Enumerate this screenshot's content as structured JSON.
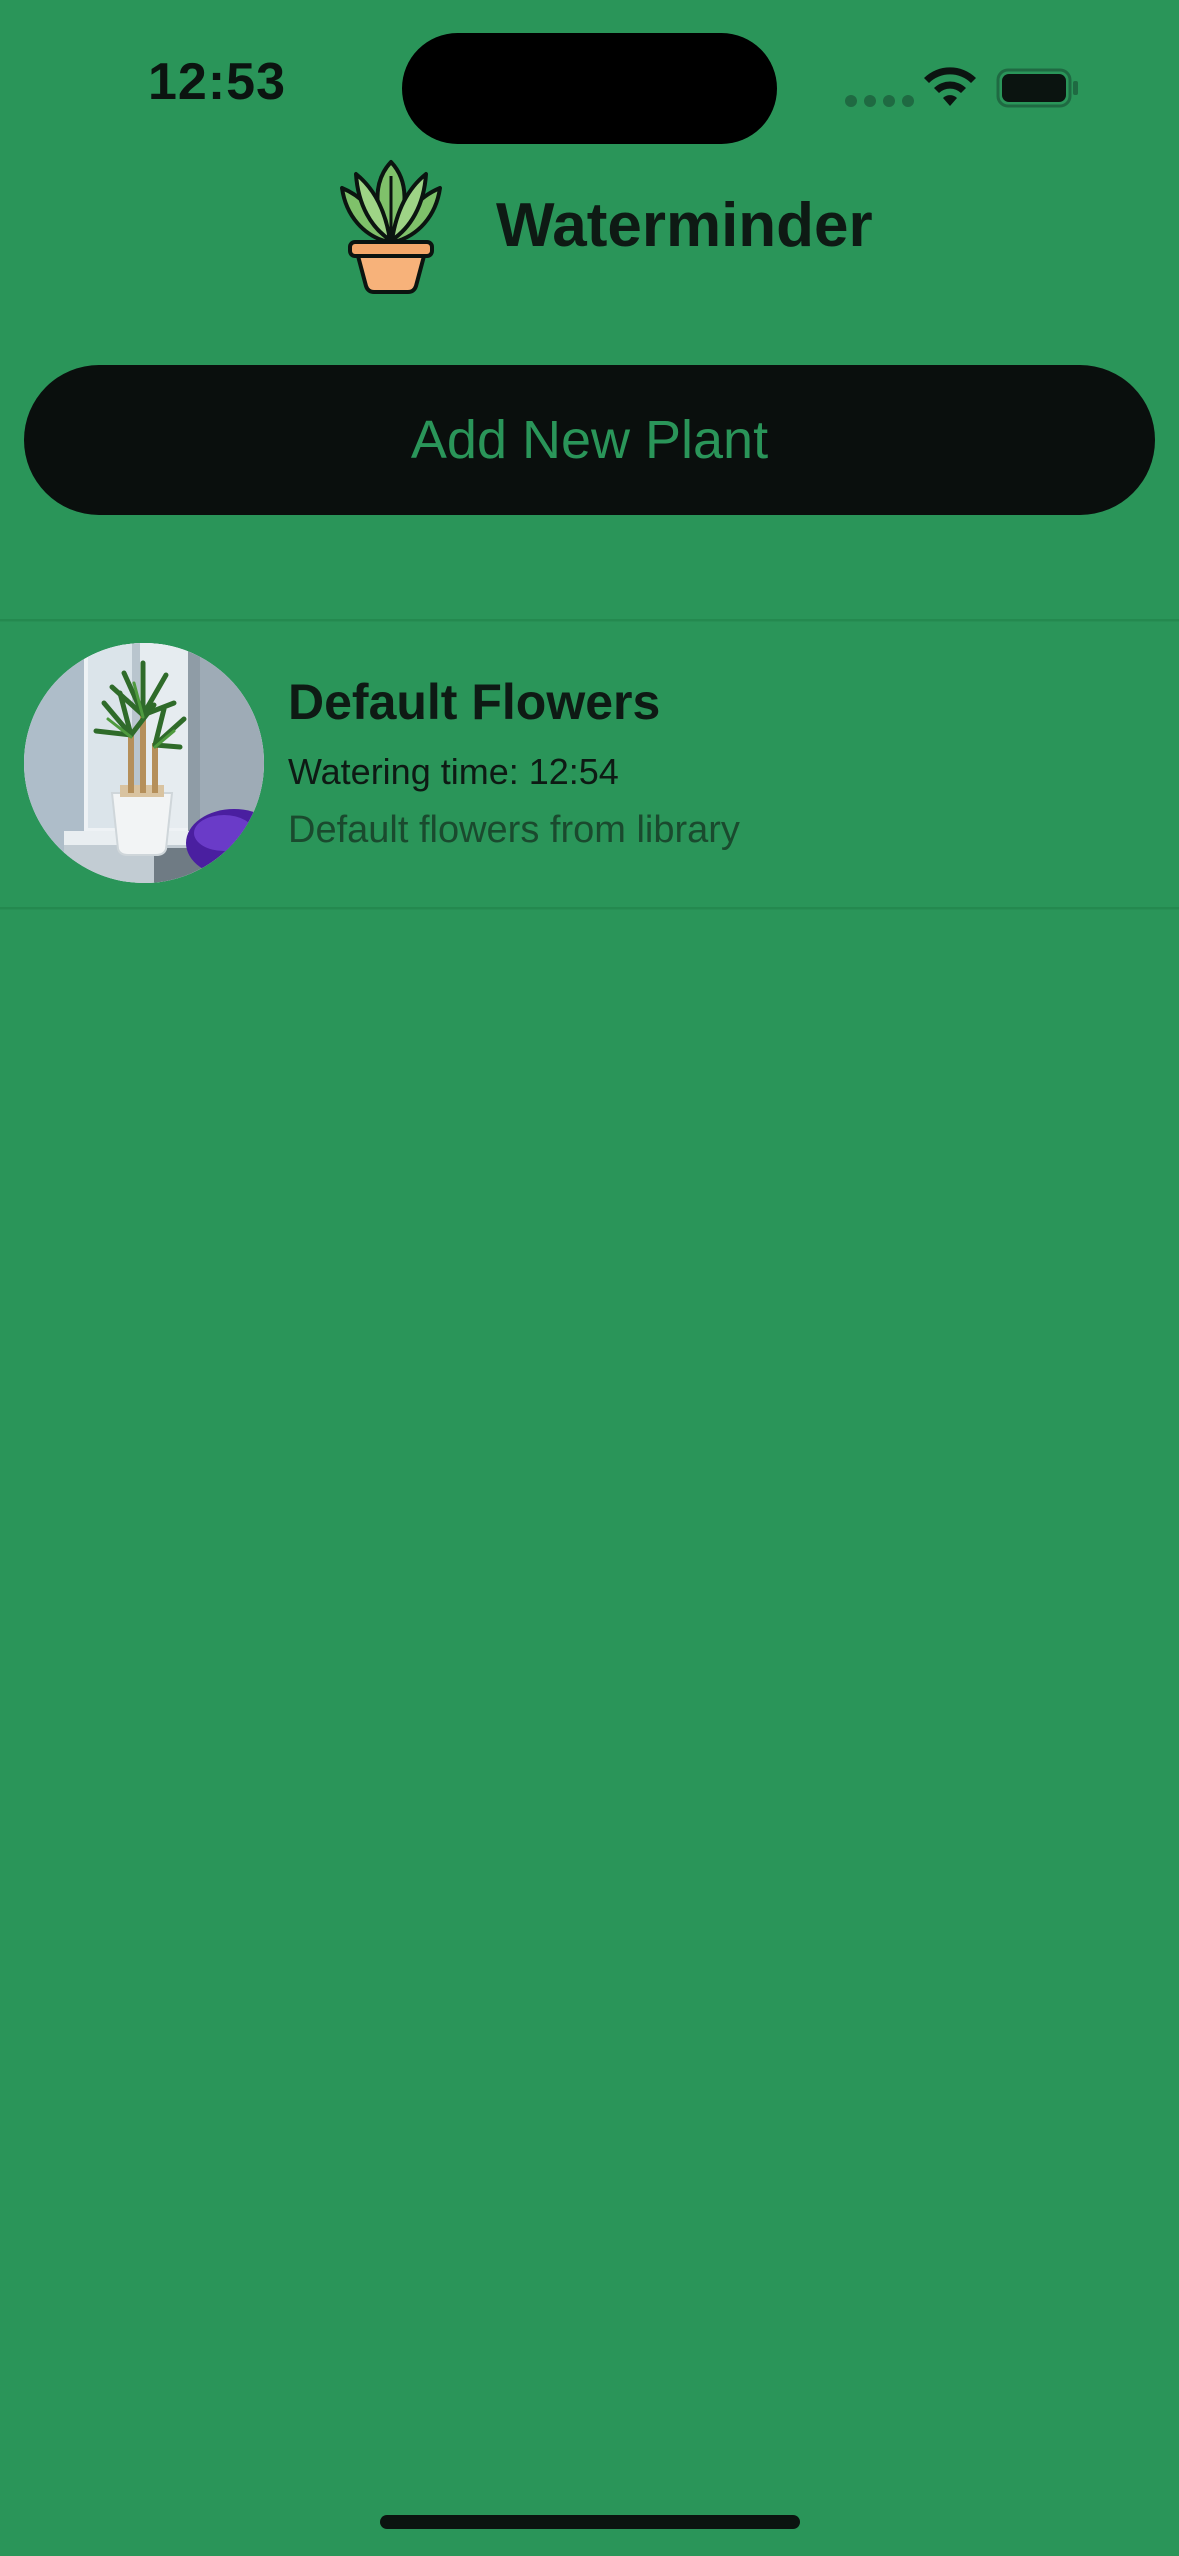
{
  "status_bar": {
    "time": "12:53",
    "icons": [
      "cellular-signal-icon",
      "wifi-icon",
      "battery-icon"
    ]
  },
  "header": {
    "title": "Waterminder",
    "logo_icon": "potted-plant-icon"
  },
  "actions": {
    "add_plant_label": "Add New Plant"
  },
  "plants": [
    {
      "name": "Default Flowers",
      "watering_time": "Watering time: 12:54",
      "description": "Default flowers from library",
      "photo": "plant-photo"
    }
  ],
  "colors": {
    "background": "#2a9559",
    "button_background": "#0a0f0d",
    "button_text": "#2a9559",
    "primary_text": "#0e1a14",
    "secondary_text": "#1a4a2e"
  }
}
